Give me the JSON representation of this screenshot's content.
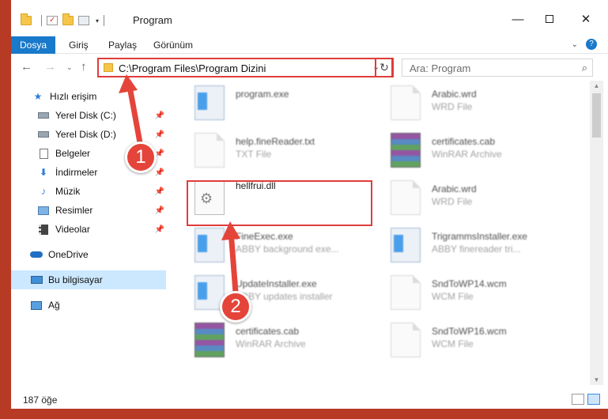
{
  "titlebar": {
    "title": "Program",
    "minimize_icon": "minimize-icon",
    "maximize_icon": "maximize-icon",
    "close_icon": "close-icon"
  },
  "ribbon": {
    "tabs": [
      {
        "label": "Dosya"
      },
      {
        "label": "Giriş"
      },
      {
        "label": "Paylaş"
      },
      {
        "label": "Görünüm"
      }
    ]
  },
  "navigation": {
    "address": "C:\\Program Files\\Program Dizini",
    "search_placeholder": "Ara: Program"
  },
  "sidebar": {
    "items": [
      {
        "label": "Hızlı erişim",
        "icon": "star-icon",
        "pinned": false
      },
      {
        "label": "Yerel Disk (C:)",
        "icon": "drive-icon",
        "pinned": true
      },
      {
        "label": "Yerel Disk (D:)",
        "icon": "drive-icon",
        "pinned": true
      },
      {
        "label": "Belgeler",
        "icon": "documents-icon",
        "pinned": true
      },
      {
        "label": "İndirmeler",
        "icon": "download-icon",
        "pinned": true
      },
      {
        "label": "Müzik",
        "icon": "music-icon",
        "pinned": true
      },
      {
        "label": "Resimler",
        "icon": "pictures-icon",
        "pinned": true
      },
      {
        "label": "Videolar",
        "icon": "videos-icon",
        "pinned": true
      },
      {
        "label": "OneDrive",
        "icon": "cloud-icon",
        "pinned": false
      },
      {
        "label": "Bu bilgisayar",
        "icon": "computer-icon",
        "pinned": false,
        "selected": true
      },
      {
        "label": "Ağ",
        "icon": "network-icon",
        "pinned": false
      }
    ]
  },
  "files": [
    {
      "name": "program.exe",
      "type": "",
      "icon": "exe"
    },
    {
      "name": "Arabic.wrd",
      "type": "WRD File",
      "icon": "doc"
    },
    {
      "name": "help.fineReader.txt",
      "type": "TXT File",
      "icon": "doc"
    },
    {
      "name": "certificates.cab",
      "type": "WinRAR Archive",
      "icon": "rar"
    },
    {
      "name": "hellfrui.dll",
      "type": "",
      "icon": "dll"
    },
    {
      "name": "Arabic.wrd",
      "type": "WRD File",
      "icon": "doc"
    },
    {
      "name": "FineExec.exe",
      "type": "ABBY background exe...",
      "icon": "exe"
    },
    {
      "name": "TrigrammsInstaller.exe",
      "type": "ABBY finereader tri...",
      "icon": "exe"
    },
    {
      "name": "UpdateInstaller.exe",
      "type": "ABBY updates installer",
      "icon": "exe"
    },
    {
      "name": "SndToWP14.wcm",
      "type": "WCM File",
      "icon": "doc"
    },
    {
      "name": "certificates.cab",
      "type": "WinRAR Archive",
      "icon": "rar"
    },
    {
      "name": "SndToWP16.wcm",
      "type": "WCM File",
      "icon": "doc"
    }
  ],
  "callouts": [
    "1",
    "2"
  ],
  "status": {
    "count": "187 öğe"
  },
  "colors": {
    "accent": "#1979ca",
    "highlight": "#e03c3c",
    "selected": "#cce8ff"
  }
}
